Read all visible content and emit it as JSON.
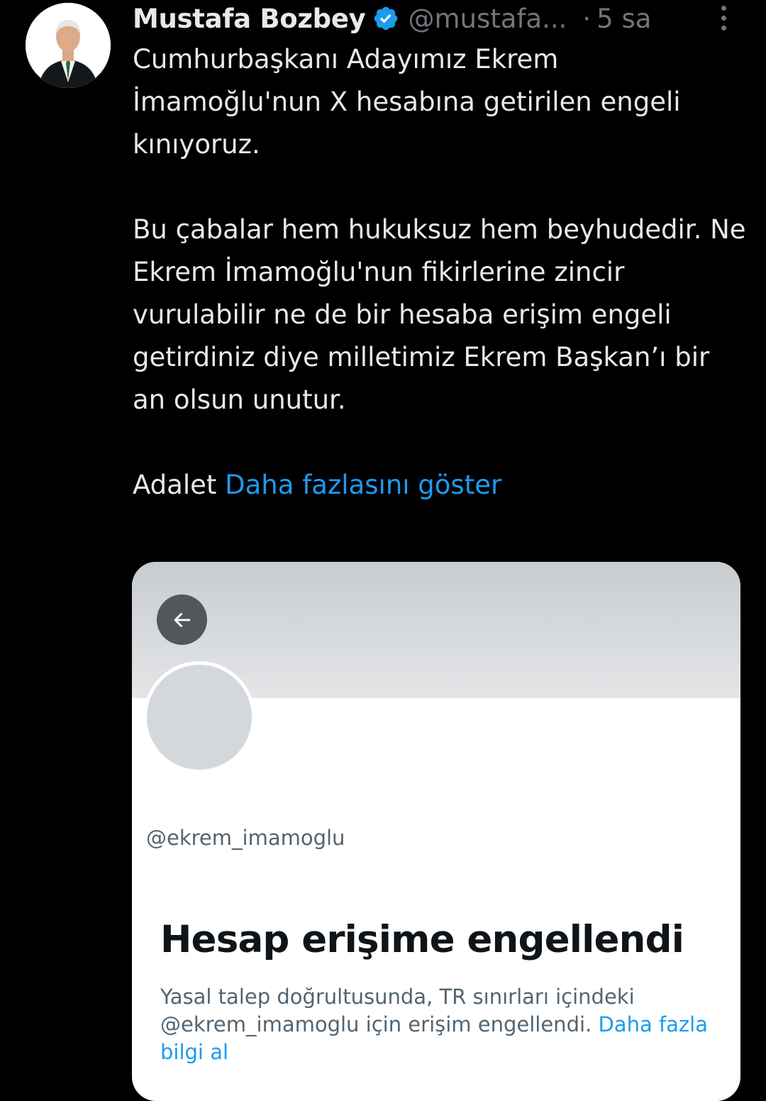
{
  "author": {
    "display_name": "Mustafa Bozbey",
    "handle": "@mustafa...",
    "separator": "·",
    "time": "5 sa",
    "verified": true,
    "avatar_icon": "person-in-suit-avatar"
  },
  "tweet": {
    "paragraphs": [
      "Cumhurbaşkanı Adayımız Ekrem İmamoğlu'nun X  hesabına getirilen engeli kınıyoruz.",
      "Bu çabalar hem hukuksuz hem beyhudedir. Ne Ekrem İmamoğlu'nun fikirlerine zincir vurulabilir ne de bir hesaba erişim engeli getirdiniz diye milletimiz Ekrem Başkan’ı bir an olsun unutur."
    ],
    "last_line_text": "Adalet",
    "show_more": "Daha fazlasını göster"
  },
  "media": {
    "card_handle": "@ekrem_imamoglu",
    "blocked_title": "Hesap erişime engellendi",
    "blocked_description": "Yasal talep doğrultusunda, TR sınırları içindeki @ekrem_imamoglu için erişim engellendi.",
    "learn_more": "Daha fazla bilgi al",
    "back_icon": "arrow-left-icon"
  },
  "colors": {
    "background": "#000000",
    "text": "#e7e9ea",
    "muted": "#71767b",
    "accent": "#1d9bf0"
  }
}
